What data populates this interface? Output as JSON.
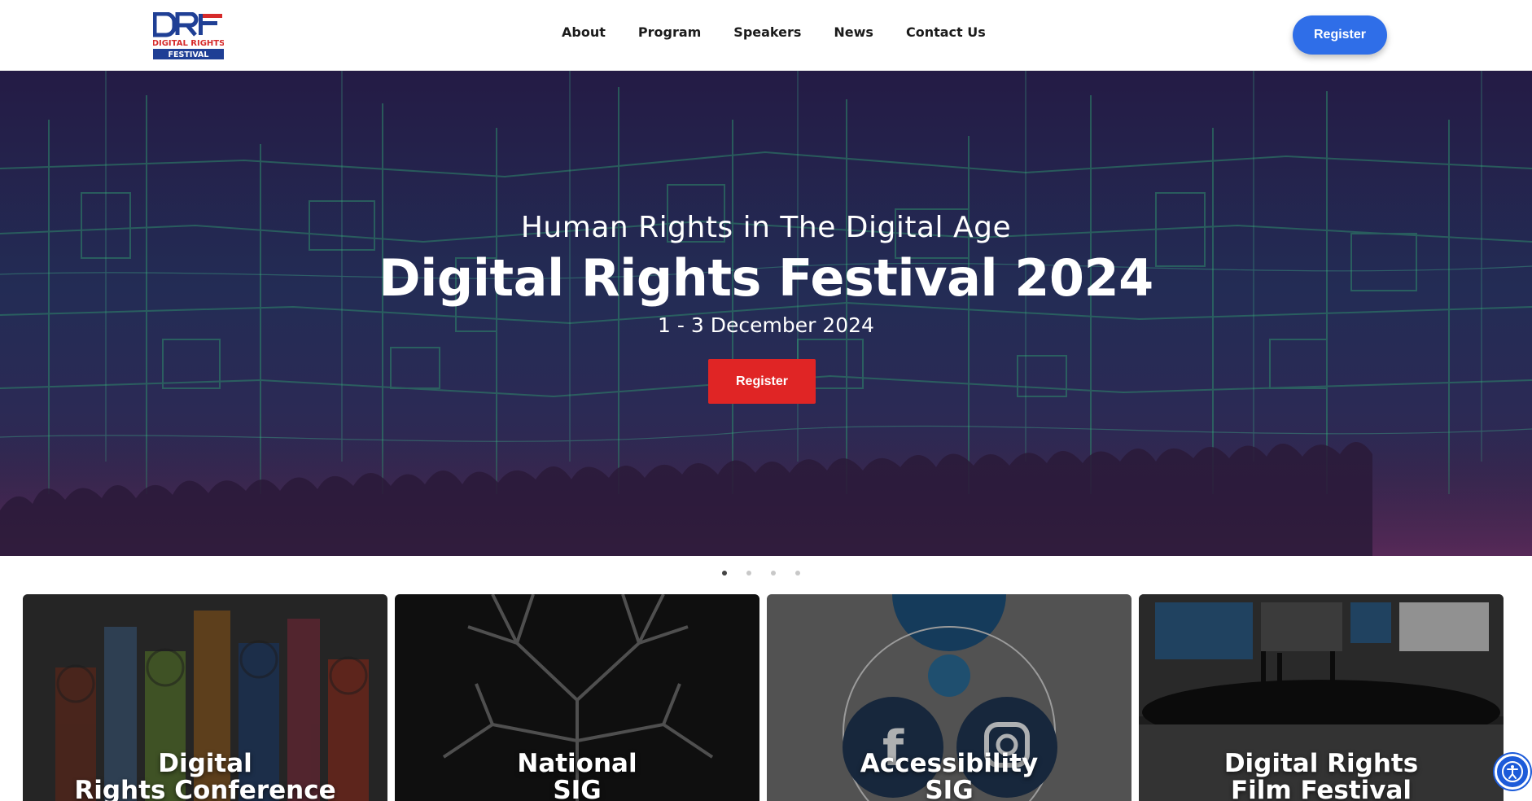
{
  "header": {
    "logo": {
      "line1": "DRF",
      "line2": "DIGITAL RIGHTS",
      "line3": "FESTIVAL"
    },
    "nav": [
      {
        "label": "About"
      },
      {
        "label": "Program"
      },
      {
        "label": "Speakers"
      },
      {
        "label": "News"
      },
      {
        "label": "Contact Us"
      }
    ],
    "register_label": "Register"
  },
  "hero": {
    "subtitle": "Human Rights in The Digital Age",
    "title": "Digital Rights Festival 2024",
    "date": "1 - 3 December 2024",
    "register_label": "Register"
  },
  "carousel": {
    "total_slides": 4,
    "active_slide": 1
  },
  "cards": [
    {
      "line1": "Digital",
      "line2": "Rights Conference"
    },
    {
      "line1": "National",
      "line2": "SIG"
    },
    {
      "line1": "Accessibility",
      "line2": "SIG"
    },
    {
      "line1": "Digital Rights",
      "line2": "Film Festival"
    }
  ],
  "accessibility_widget": {
    "icon": "accessibility-icon"
  },
  "colors": {
    "primary_blue": "#2f6ee8",
    "hero_red": "#e02525",
    "hero_bg": "#241b45",
    "lines_green": "#2e8a6a"
  }
}
